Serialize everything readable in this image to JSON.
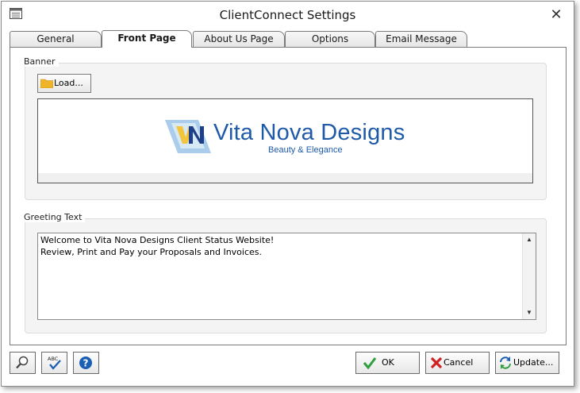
{
  "window": {
    "title": "ClientConnect Settings"
  },
  "tabs": [
    {
      "label": "General",
      "active": false
    },
    {
      "label": "Front Page",
      "active": true
    },
    {
      "label": "About Us Page",
      "active": false
    },
    {
      "label": "Options",
      "active": false
    },
    {
      "label": "Email Message",
      "active": false
    }
  ],
  "banner": {
    "group_label": "Banner",
    "load_label": "Load...",
    "logo_mark": "VN",
    "logo_name": "Vita Nova Designs",
    "logo_tagline": "Beauty & Elegance"
  },
  "greeting": {
    "group_label": "Greeting Text",
    "lines": [
      "Welcome to Vita Nova Designs Client Status Website!",
      "Review, Print and Pay your Proposals and Invoices."
    ]
  },
  "buttons": {
    "ok": "OK",
    "cancel": "Cancel",
    "update": "Update..."
  },
  "icons": {
    "app": "settings-window-icon",
    "close": "close-icon",
    "search": "magnifier-icon",
    "spellcheck": "spellcheck-icon",
    "help": "help-icon",
    "ok": "checkmark-icon",
    "cancel": "red-x-icon",
    "update": "refresh-icon",
    "folder": "folder-icon"
  },
  "colors": {
    "logo_blue": "#1e5aa8",
    "help_blue": "#1a5fb4",
    "ok_green": "#2e9e3e",
    "cancel_red": "#d02020",
    "folder_yellow": "#f0b429"
  }
}
